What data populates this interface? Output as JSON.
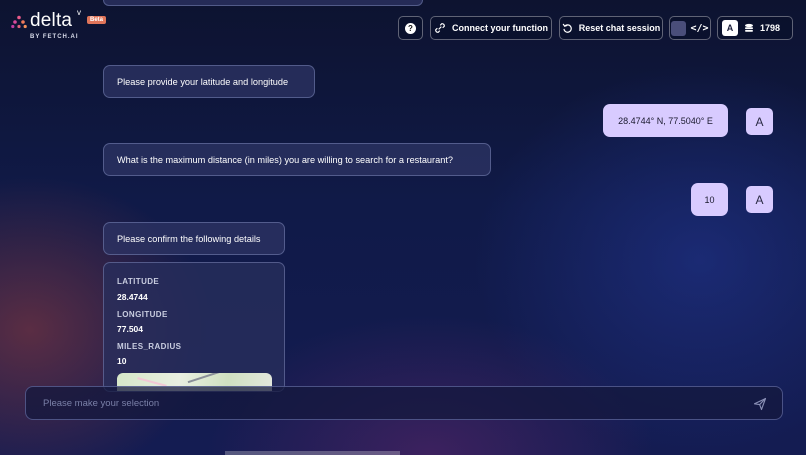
{
  "header": {
    "logo_text": "delta",
    "logo_caret": "v",
    "beta_label": "Beta",
    "byline": "BY FETCH.AI",
    "help_symbol": "?",
    "connect_label": "Connect your function",
    "reset_label": "Reset chat session",
    "code_symbol": "</>",
    "user_initial": "A",
    "credits": "1798"
  },
  "chat": {
    "messages": [
      {
        "role": "bot",
        "text": "Please provide your latitude and longitude"
      },
      {
        "role": "user",
        "text": "28.4744° N, 77.5040° E",
        "avatar": "A"
      },
      {
        "role": "bot",
        "text": "What is the maximum distance (in miles) you are willing to search for a restaurant?"
      },
      {
        "role": "user",
        "text": "10",
        "avatar": "A"
      },
      {
        "role": "bot",
        "text": "Please confirm the following details"
      }
    ],
    "details": [
      {
        "label": "LATITUDE",
        "value": "28.4744"
      },
      {
        "label": "LONGITUDE",
        "value": "77.504"
      },
      {
        "label": "MILES_RADIUS",
        "value": "10"
      }
    ]
  },
  "input": {
    "placeholder": "Please make your selection",
    "value": ""
  },
  "icons": {
    "logo": "delta-logo-icon",
    "help": "help-icon",
    "connect": "link-icon",
    "reset": "reset-icon",
    "code": "code-icon",
    "credits": "coins-icon",
    "send": "send-icon"
  },
  "colors": {
    "accent_user_bubble": "#d8cbff",
    "beta_badge": "#e0755a",
    "background": "#101a48"
  }
}
